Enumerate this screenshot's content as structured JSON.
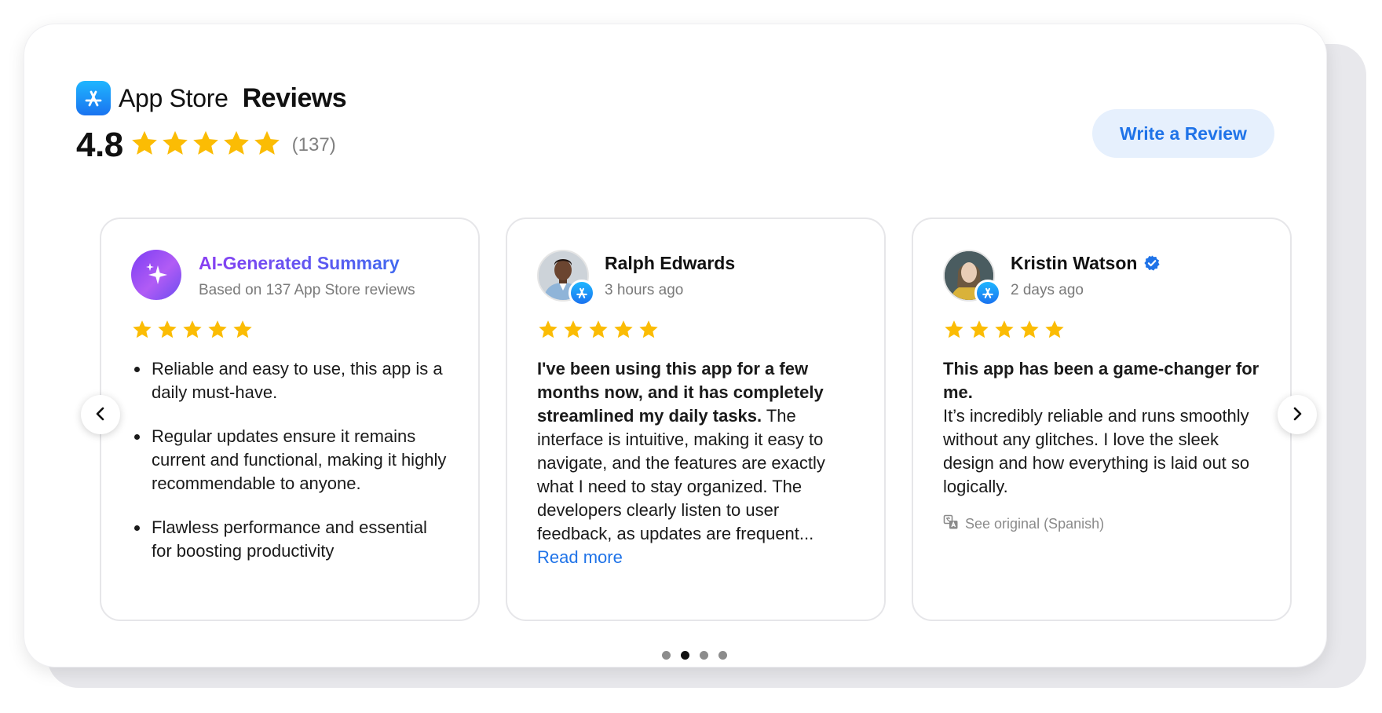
{
  "header": {
    "brand_name": "App Store",
    "title": "Reviews",
    "rating_value": "4.8",
    "rating_stars": 5,
    "review_count": "(137)",
    "write_review_label": "Write a Review"
  },
  "colors": {
    "star": "#FBBC04",
    "accent_blue": "#1F73E8",
    "button_bg": "#E6F0FD",
    "ai_gradient_start": "#8A3FF2",
    "ai_gradient_end": "#3B6DF0"
  },
  "cards": [
    {
      "type": "ai-summary",
      "icon": "sparkles-icon",
      "title": "AI-Generated Summary",
      "subtitle": "Based on 137 App Store reviews",
      "stars": 5,
      "points": [
        "Reliable and easy to use, this app is a daily must-have.",
        "Regular updates ensure it remains current and functional, making it highly recommendable to anyone.",
        "Flawless performance and essential for boosting productivity"
      ]
    },
    {
      "type": "review",
      "author": "Ralph Edwards",
      "time": "3 hours ago",
      "source_icon": "app-store-icon",
      "stars": 5,
      "headline": "I've been using this app for a few months now, and it has completely streamlined my daily tasks.",
      "body": " The interface is intuitive, making it easy to navigate, and the features are exactly what I need to stay organized. The developers clearly listen to user feedback, as updates are frequent...",
      "read_more": "Read more"
    },
    {
      "type": "review",
      "author": "Kristin Watson",
      "verified": true,
      "time": "2 days ago",
      "source_icon": "app-store-icon",
      "stars": 5,
      "headline": "This app has been a game-changer for me.",
      "body": "It’s incredibly reliable and runs smoothly without any glitches. I love the sleek design and how everything is laid out so logically.",
      "see_original": "See original (Spanish)"
    }
  ],
  "carousel": {
    "prev_icon": "chevron-left-icon",
    "next_icon": "chevron-right-icon",
    "page_count": 4,
    "active_index": 1
  }
}
